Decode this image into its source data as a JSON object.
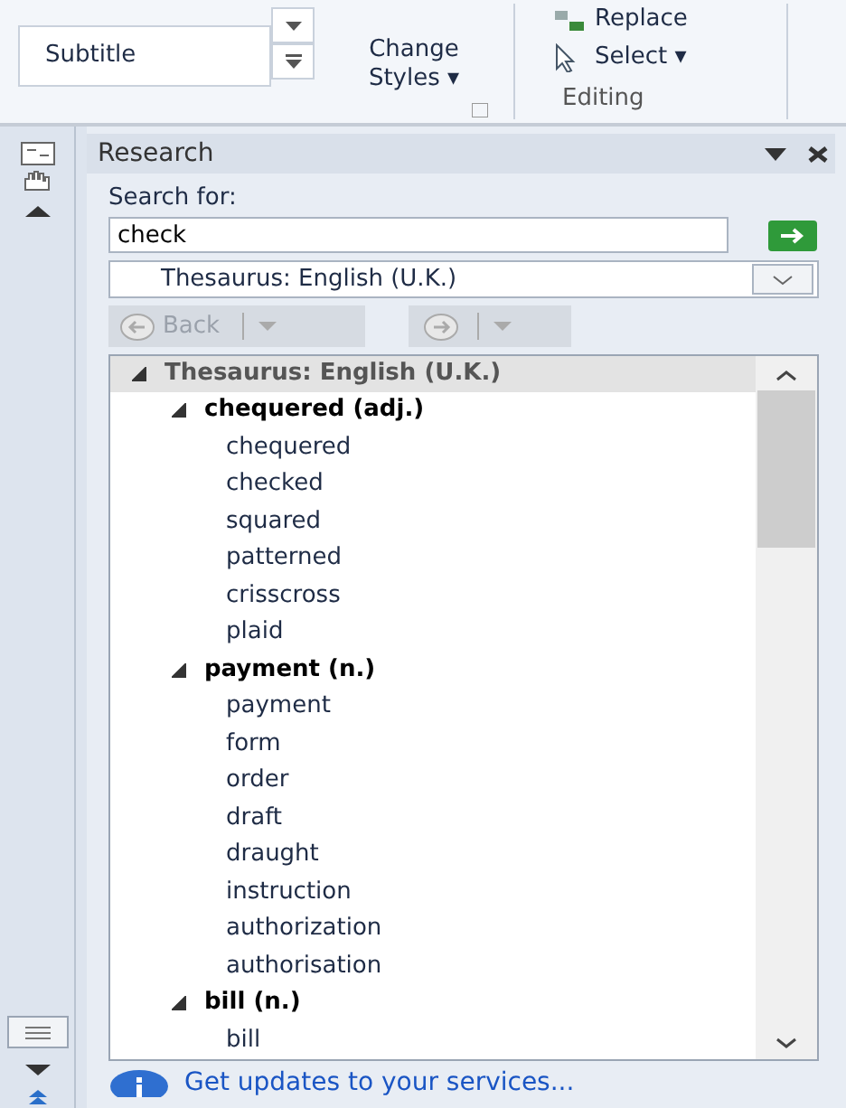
{
  "ribbon": {
    "style_gallery": {
      "item": "Subtitle"
    },
    "change_styles": {
      "label": "Change Styles",
      "caret": "▾"
    },
    "editing": {
      "replace": "Replace",
      "select": "Select",
      "caret": "▾",
      "group_label": "Editing"
    }
  },
  "research": {
    "title": "Research",
    "search_label": "Search for:",
    "search_value": "check",
    "source": "Thesaurus: English (U.K.)",
    "back_button": {
      "label": "Back",
      "disabled": true
    },
    "forward_button": {
      "disabled": true
    },
    "results": {
      "label": "Thesaurus: English (U.K.)",
      "expanded": true,
      "children": [
        {
          "label": "chequered (adj.)",
          "expanded": true,
          "children": [
            {
              "label": "chequered"
            },
            {
              "label": "checked"
            },
            {
              "label": "squared"
            },
            {
              "label": "patterned"
            },
            {
              "label": "crisscross"
            },
            {
              "label": "plaid"
            }
          ]
        },
        {
          "label": "payment (n.)",
          "expanded": true,
          "children": [
            {
              "label": "payment"
            },
            {
              "label": "form"
            },
            {
              "label": "order"
            },
            {
              "label": "draft"
            },
            {
              "label": "draught"
            },
            {
              "label": "instruction"
            },
            {
              "label": "authorization"
            },
            {
              "label": "authorisation"
            }
          ]
        },
        {
          "label": "bill (n.)",
          "expanded": true,
          "children": [
            {
              "label": "bill"
            }
          ]
        }
      ]
    },
    "footer_link": "Get updates to your services..."
  }
}
